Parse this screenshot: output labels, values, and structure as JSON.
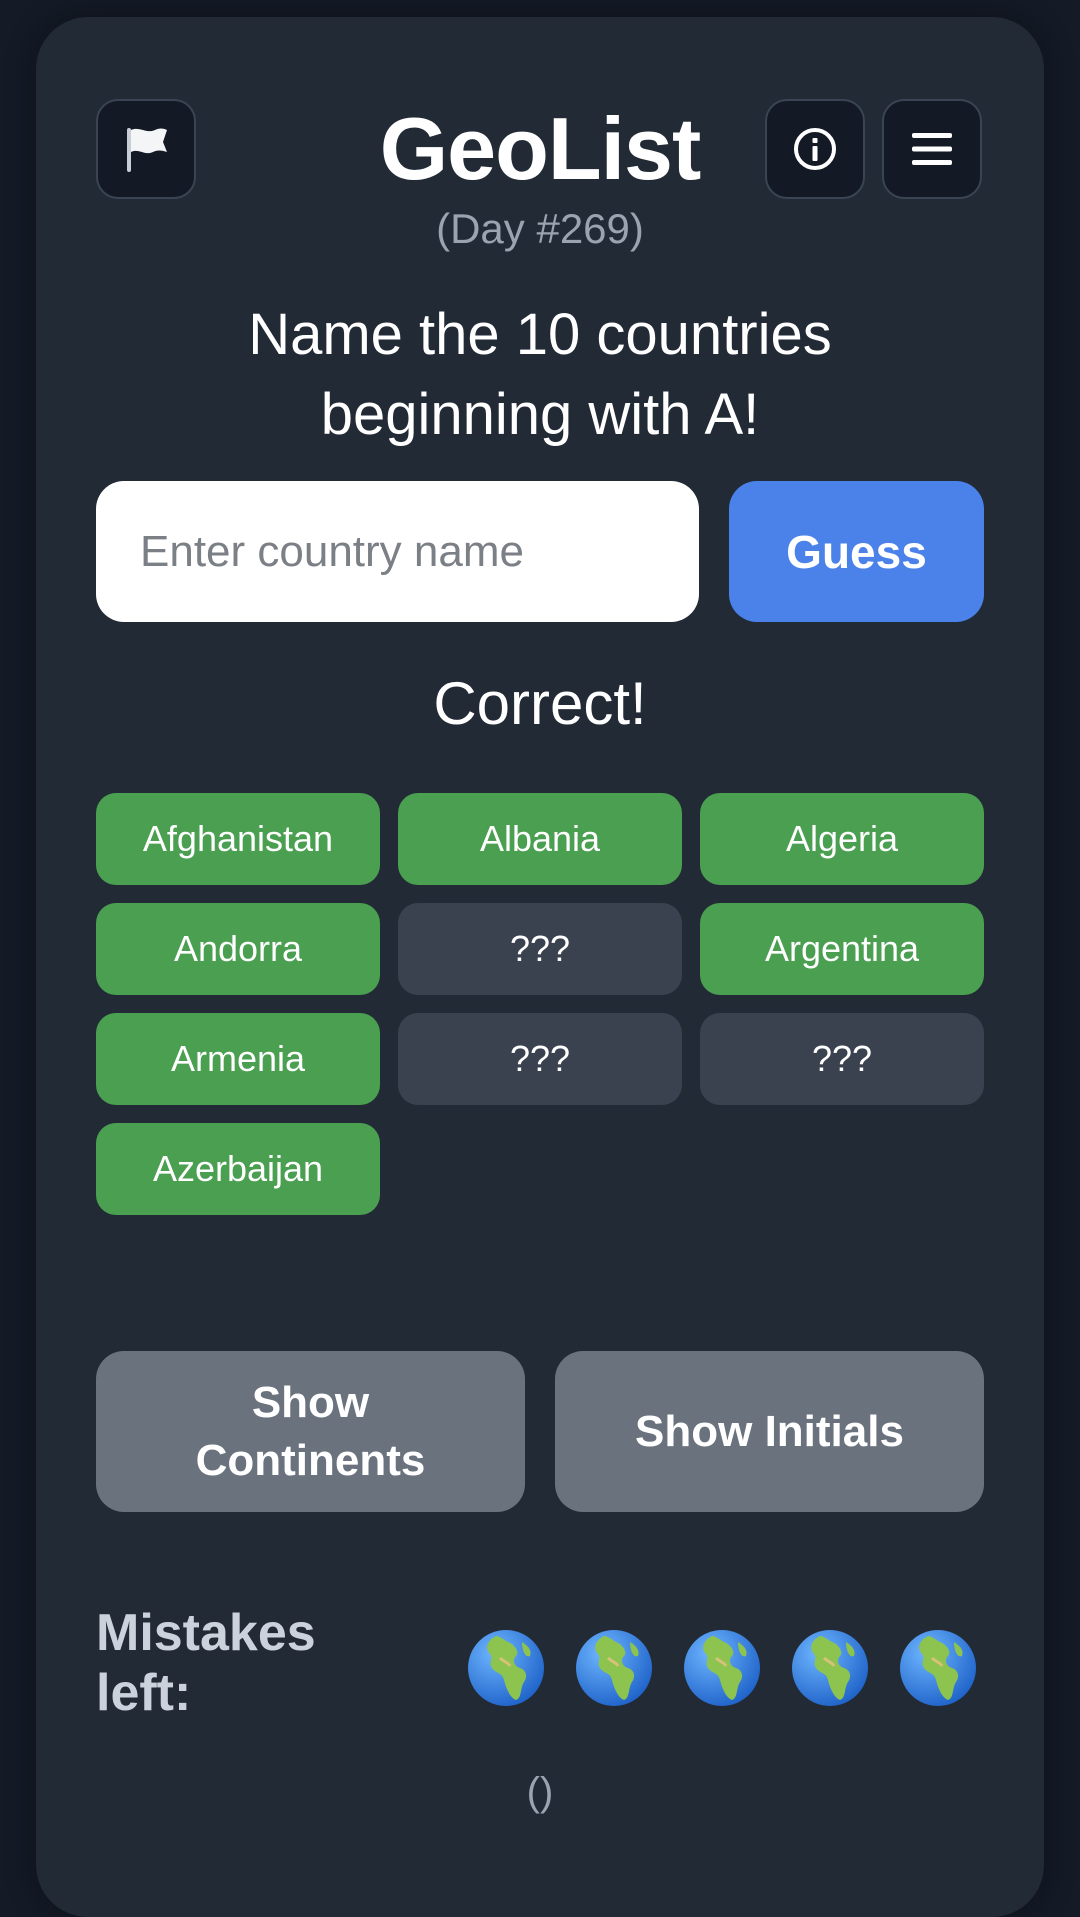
{
  "header": {
    "title": "GeoList",
    "subtitle": "(Day #269)",
    "icons": {
      "left": "flag-icon",
      "info": "info-icon",
      "menu": "menu-icon"
    }
  },
  "prompt": "Name the 10 countries\nbeginning with A!",
  "search": {
    "placeholder": "Enter country name",
    "value": "",
    "button_label": "Guess"
  },
  "status_message": "Correct!",
  "answers": [
    {
      "label": "Afghanistan",
      "found": true
    },
    {
      "label": "Albania",
      "found": true
    },
    {
      "label": "Algeria",
      "found": true
    },
    {
      "label": "Andorra",
      "found": true
    },
    {
      "label": "???",
      "found": false
    },
    {
      "label": "Argentina",
      "found": true
    },
    {
      "label": "Armenia",
      "found": true
    },
    {
      "label": "???",
      "found": false
    },
    {
      "label": "???",
      "found": false
    },
    {
      "label": "Azerbaijan",
      "found": true
    }
  ],
  "hints": {
    "continents_label": "Show\nContinents",
    "initials_label": "Show Initials"
  },
  "mistakes": {
    "label": "Mistakes\nleft:",
    "remaining": 5,
    "icon": "globe-icon"
  },
  "footer_text": "()",
  "colors": {
    "background": "#141a26",
    "card": "#222a35",
    "accent": "#4b82ea",
    "found": "#4a9f51",
    "hidden": "#3a4250",
    "hint_button": "#6a727e"
  }
}
